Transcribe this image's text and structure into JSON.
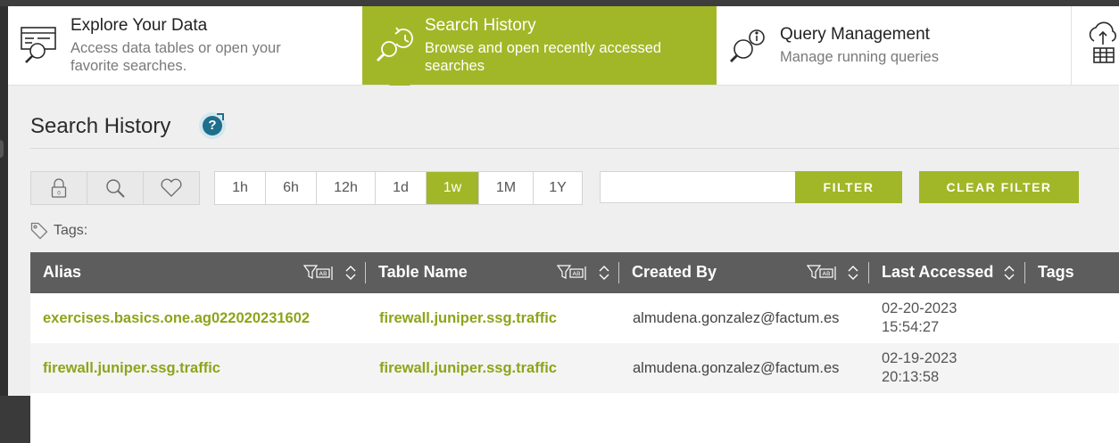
{
  "nav": {
    "explore": {
      "title": "Explore Your Data",
      "desc": "Access data tables or open your favorite searches."
    },
    "search": {
      "title": "Search History",
      "desc": "Browse and open recently accessed searches"
    },
    "query": {
      "title": "Query Management",
      "desc": "Manage running queries"
    }
  },
  "page": {
    "title": "Search History",
    "help": "?"
  },
  "time_filters": [
    "1h",
    "6h",
    "12h",
    "1d",
    "1w",
    "1M",
    "1Y"
  ],
  "active_time_filter": "1w",
  "filter": {
    "value": "",
    "placeholder": "",
    "button": "FILTER",
    "clear_button": "CLEAR FILTER"
  },
  "tags_label": "Tags:",
  "table": {
    "columns": [
      "Alias",
      "Table Name",
      "Created By",
      "Last Accessed",
      "Tags"
    ],
    "rows": [
      {
        "alias": "exercises.basics.one.ag022020231602",
        "table": "firewall.juniper.ssg.traffic",
        "created_by": "almudena.gonzalez@factum.es",
        "date": "02-20-2023",
        "time": "15:54:27"
      },
      {
        "alias": "firewall.juniper.ssg.traffic",
        "table": "firewall.juniper.ssg.traffic",
        "created_by": "almudena.gonzalez@factum.es",
        "date": "02-19-2023",
        "time": "20:13:58"
      }
    ]
  },
  "colors": {
    "accent": "#a2b727",
    "header_bg": "#5d5d5d",
    "link": "#8fa31a"
  }
}
